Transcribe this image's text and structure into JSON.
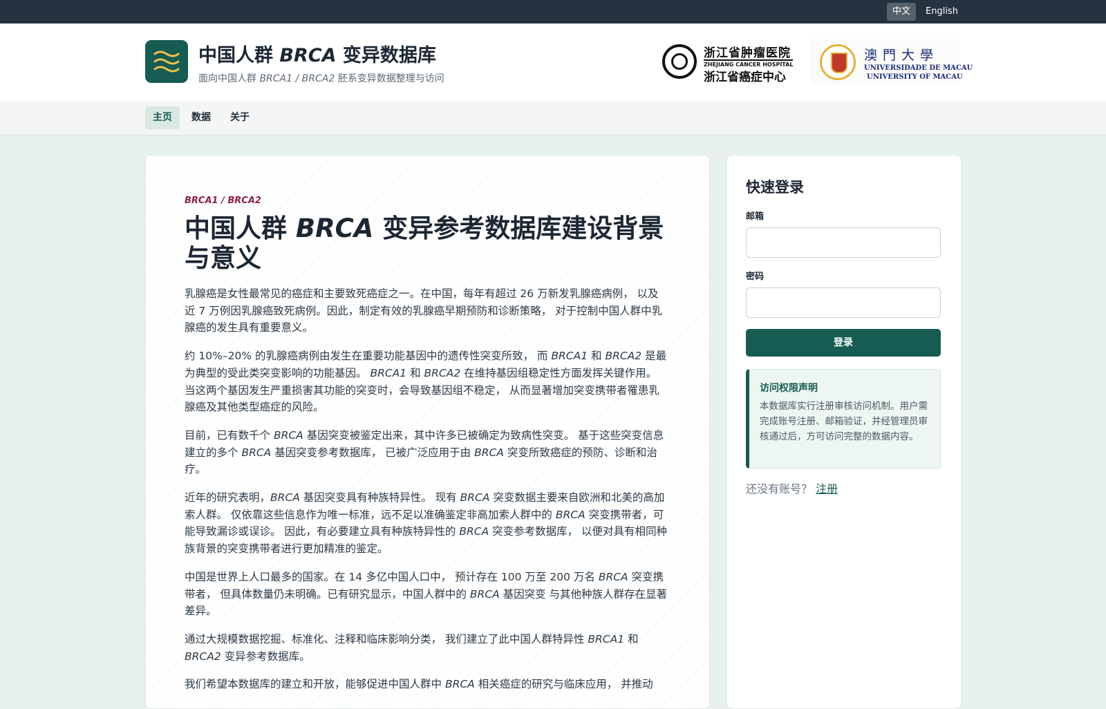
{
  "lang_switch": {
    "zh": "中文",
    "en": "English"
  },
  "header": {
    "title_pre": "中国人群 ",
    "title_em": "BRCA",
    "title_post": " 变异数据库",
    "sub_pre": "面向中国人群 ",
    "sub_em": "BRCA1 / BRCA2",
    "sub_post": " 胚系变异数据整理与访问",
    "partner1": {
      "cn_top": "浙江省肿瘤医院",
      "en": "ZHEJIANG CANCER HOSPITAL",
      "cn": "浙江省癌症中心"
    },
    "partner2": {
      "cn": "澳門大學",
      "en1": "UNIVERSIDADE DE MACAU",
      "en2": "UNIVERSITY OF MACAU"
    }
  },
  "nav": {
    "home": "主页",
    "data": "数据",
    "about": "关于"
  },
  "article": {
    "kicker": "BRCA1 / BRCA2",
    "title_pre": "中国人群 ",
    "title_em": "BRCA",
    "title_post": " 变异参考数据库建设背景与意义",
    "paragraphs": [
      {
        "segments": [
          {
            "text": "乳腺癌是女性最常见的癌症和主要致死癌症之一。在中国，每年有超过 26 万新发乳腺癌病例， 以及近 7 万例因乳腺癌致死病例。因此，制定有效的乳腺癌早期预防和诊断策略， 对于控制中国人群中乳腺癌的发生具有重要意义。"
          }
        ]
      },
      {
        "segments": [
          {
            "text": "约 10%–20% 的乳腺癌病例由发生在重要功能基因中的遗传性突变所致， 而 "
          },
          {
            "text": "BRCA1",
            "em": true
          },
          {
            "text": " 和 "
          },
          {
            "text": "BRCA2",
            "em": true
          },
          {
            "text": " 是最为典型的受此类突变影响的功能基因。 "
          },
          {
            "text": "BRCA1",
            "em": true
          },
          {
            "text": " 和 "
          },
          {
            "text": "BRCA2",
            "em": true
          },
          {
            "text": " 在维持基因组稳定性方面发挥关键作用。 当这两个基因发生严重损害其功能的突变时，会导致基因组不稳定， 从而显著增加突变携带者罹患乳腺癌及其他类型癌症的风险。"
          }
        ]
      },
      {
        "segments": [
          {
            "text": "目前，已有数千个 "
          },
          {
            "text": "BRCA",
            "em": true
          },
          {
            "text": " 基因突变被鉴定出来，其中许多已被确定为致病性突变。 基于这些突变信息建立的多个 "
          },
          {
            "text": "BRCA",
            "em": true
          },
          {
            "text": " 基因突变参考数据库， 已被广泛应用于由 "
          },
          {
            "text": "BRCA",
            "em": true
          },
          {
            "text": " 突变所致癌症的预防、诊断和治疗。"
          }
        ]
      },
      {
        "segments": [
          {
            "text": "近年的研究表明，"
          },
          {
            "text": "BRCA",
            "em": true
          },
          {
            "text": " 基因突变具有种族特异性。 现有 "
          },
          {
            "text": "BRCA",
            "em": true
          },
          {
            "text": " 突变数据主要来自欧洲和北美的高加索人群。 仅依靠这些信息作为唯一标准，远不足以准确鉴定非高加索人群中的 "
          },
          {
            "text": "BRCA",
            "em": true
          },
          {
            "text": " 突变携带者，可能导致漏诊或误诊。 因此，有必要建立具有种族特异性的 "
          },
          {
            "text": "BRCA",
            "em": true
          },
          {
            "text": " 突变参考数据库， 以便对具有相同种族背景的突变携带者进行更加精准的鉴定。"
          }
        ]
      },
      {
        "segments": [
          {
            "text": "中国是世界上人口最多的国家。在 14 多亿中国人口中， 预计存在 100 万至 200 万名 "
          },
          {
            "text": "BRCA",
            "em": true
          },
          {
            "text": " 突变携带者， 但具体数量仍未明确。已有研究显示，中国人群中的 "
          },
          {
            "text": "BRCA",
            "em": true
          },
          {
            "text": " 基因突变 与其他种族人群存在显著差异。"
          }
        ]
      },
      {
        "segments": [
          {
            "text": "通过大规模数据挖掘、标准化、注释和临床影响分类， 我们建立了此中国人群特异性 "
          },
          {
            "text": "BRCA1",
            "em": true
          },
          {
            "text": " 和 "
          },
          {
            "text": "BRCA2",
            "em": true
          },
          {
            "text": " 变异参考数据库。"
          }
        ]
      },
      {
        "segments": [
          {
            "text": "我们希望本数据库的建立和开放，能够促进中国人群中 "
          },
          {
            "text": "BRCA",
            "em": true
          },
          {
            "text": " 相关癌症的研究与临床应用， 并推动"
          }
        ]
      }
    ]
  },
  "login": {
    "title": "快速登录",
    "email_label": "邮箱",
    "email_value": "",
    "password_label": "密码",
    "password_value": "",
    "submit": "登录",
    "notice_title": "访问权限声明",
    "notice_body": "本数据库实行注册审核访问机制。用户需完成账号注册、邮箱验证，并经管理员审核通过后，方可访问完整的数据内容。",
    "register_prompt": "还没有账号？",
    "register_link": "注册"
  },
  "colors": {
    "brand": "#175c52",
    "accent": "#8e2244",
    "topbar": "#253240"
  }
}
